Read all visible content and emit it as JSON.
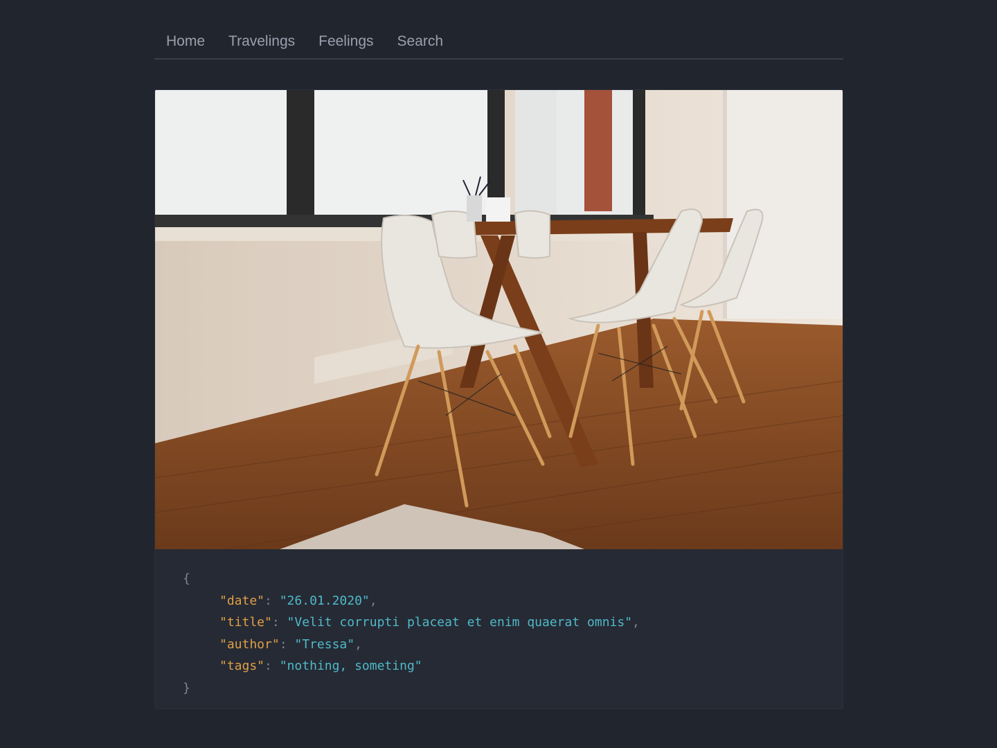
{
  "nav": {
    "items": [
      "Home",
      "Travelings",
      "Feelings",
      "Search"
    ]
  },
  "post": {
    "image_alt": "White chairs around a wooden table in a bright room",
    "code": {
      "open_brace": "{",
      "close_brace": "}",
      "fields": [
        {
          "key": "\"date\"",
          "value": "\"26.01.2020\"",
          "comma": ","
        },
        {
          "key": "\"title\"",
          "value": "\"Velit corrupti placeat et enim quaerat omnis\"",
          "comma": ","
        },
        {
          "key": "\"author\"",
          "value": "\"Tressa\"",
          "comma": ","
        },
        {
          "key": "\"tags\"",
          "value": "\"nothing, someting\"",
          "comma": ""
        }
      ]
    }
  },
  "colors": {
    "background": "#21252e",
    "card": "#262a34",
    "nav_text": "#98a1ad",
    "json_key": "#e0a047",
    "json_string": "#4fb9c9"
  }
}
